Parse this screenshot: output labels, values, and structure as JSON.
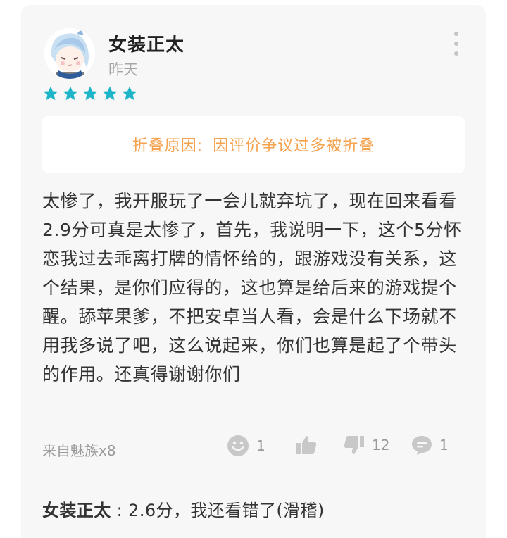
{
  "review": {
    "username": "女装正太",
    "date": "昨天",
    "rating": 5,
    "star_color": "#1fb5c8",
    "fold_notice": {
      "label": "折叠原因:",
      "reason": "因评价争议过多被折叠"
    },
    "body": "太惨了，我开服玩了一会儿就弃坑了，现在回来看看2.9分可真是太惨了，首先，我说明一下，这个5分怀恋我过去乖离打牌的情怀给的，跟游戏没有关系，这个结果，是你们应得的，这也算是给后来的游戏提个醒。舔苹果爹，不把安卓当人看，会是什么下场就不用我多说了吧，这么说起来，你们也算是起了个带头的作用。还真得谢谢你们",
    "source": "来自魅族x8",
    "actions": {
      "emoji_count": "1",
      "like_count": "",
      "dislike_count": "12",
      "comment_count": "1"
    }
  },
  "reply": {
    "author": "女装正太",
    "separator": " : ",
    "text": "2.6分，我还看错了(滑稽)"
  },
  "colors": {
    "fold_text": "#f5a24f",
    "icon_gray": "#c8c8c8"
  }
}
